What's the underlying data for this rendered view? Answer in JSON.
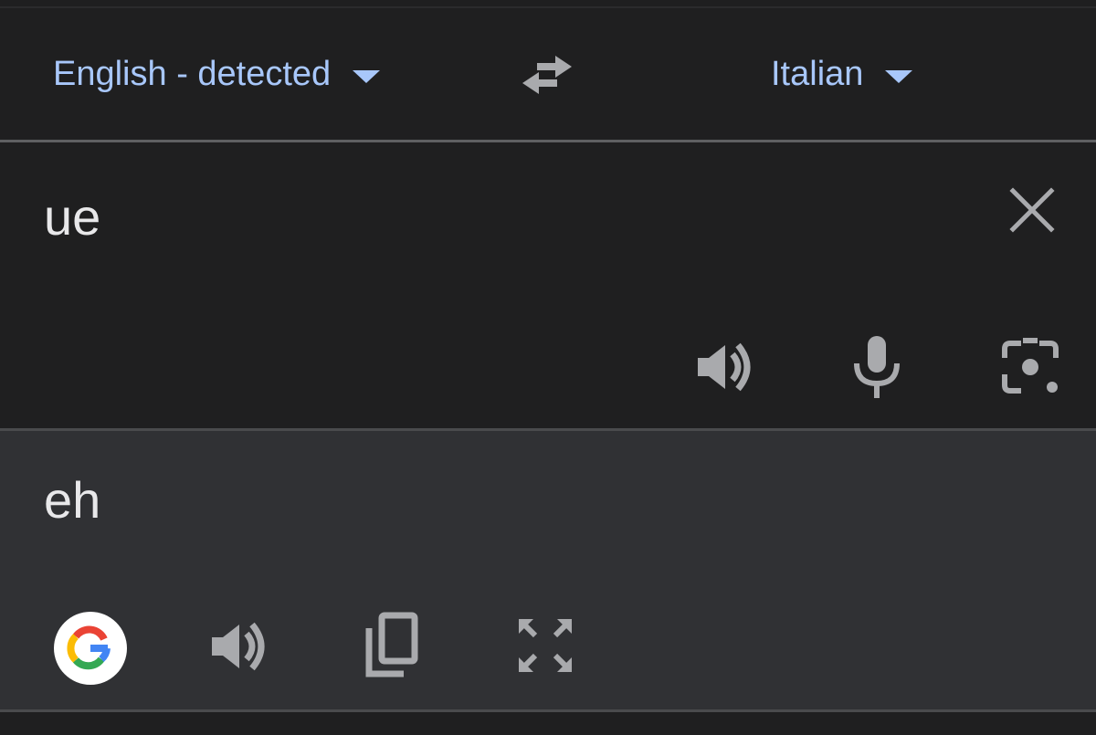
{
  "languages": {
    "source": "English - detected",
    "target": "Italian",
    "accent_color": "#a8c7fa"
  },
  "source": {
    "text": "ue"
  },
  "result": {
    "text": "eh"
  },
  "icons": {
    "swap": "swap-languages-icon",
    "clear": "close-icon",
    "source_speak": "speaker-icon",
    "mic": "microphone-icon",
    "camera": "camera-lens-icon",
    "google": "google-logo-icon",
    "result_speak": "speaker-icon",
    "copy": "copy-icon",
    "fullscreen": "fullscreen-icon"
  },
  "colors": {
    "background": "#1f1f20",
    "result_background": "#303134",
    "icon_gray": "#a9aaad",
    "text": "#e8e8ea"
  }
}
